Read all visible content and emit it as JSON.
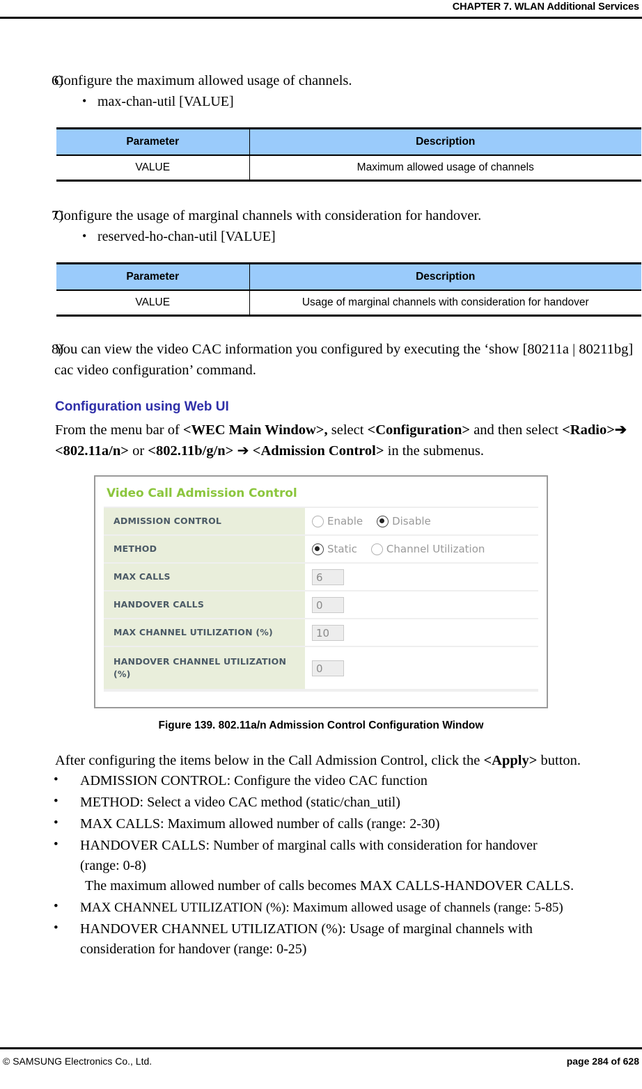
{
  "header": {
    "chapter_title": "CHAPTER 7. WLAN Additional Services"
  },
  "steps": [
    {
      "number": "6)",
      "text": "Configure the maximum allowed usage of channels.",
      "bullet": "max-chan-util  [VALUE]",
      "table": {
        "headers": [
          "Parameter",
          "Description"
        ],
        "rows": [
          [
            "VALUE",
            "Maximum allowed usage of channels"
          ]
        ]
      }
    },
    {
      "number": "7)",
      "text": "Configure the usage of marginal channels with consideration for handover.",
      "bullet": "reserved-ho-chan-util  [VALUE]",
      "table": {
        "headers": [
          "Parameter",
          "Description"
        ],
        "rows": [
          [
            "VALUE",
            "Usage of marginal channels with consideration for handover"
          ]
        ]
      }
    },
    {
      "number": "8)",
      "text": "You can view the video CAC information you configured by executing the ‘show [80211a | 80211bg] cac video configuration’ command."
    }
  ],
  "section": {
    "heading": "Configuration using Web UI",
    "paragraph_plain_1": "From the menu bar of ",
    "paragraph_bold_1": "<WEC Main Window>,",
    "paragraph_plain_2": " select ",
    "paragraph_bold_2": "<Configuration>",
    "paragraph_plain_3": " and then select ",
    "paragraph_bold_3": "<Radio>➔",
    "paragraph_bold_4": "<802.11a/n>",
    "paragraph_plain_4": " or ",
    "paragraph_bold_5": "<802.11b/g/n>",
    "paragraph_plain_5": " ➔ ",
    "paragraph_bold_6": "<Admission Control>",
    "paragraph_plain_6": " in the submenus."
  },
  "webui": {
    "panel_title": "Video Call Admission Control",
    "rows": [
      {
        "label": "ADMISSION CONTROL",
        "type": "radio",
        "options": [
          {
            "label": "Enable",
            "selected": false
          },
          {
            "label": "Disable",
            "selected": true
          }
        ]
      },
      {
        "label": "METHOD",
        "type": "radio",
        "options": [
          {
            "label": "Static",
            "selected": true
          },
          {
            "label": "Channel Utilization",
            "selected": false
          }
        ]
      },
      {
        "label": "MAX CALLS",
        "type": "input",
        "value": "6"
      },
      {
        "label": "HANDOVER CALLS",
        "type": "input",
        "value": "0"
      },
      {
        "label": "MAX CHANNEL UTILIZATION (%)",
        "type": "input",
        "value": "10"
      },
      {
        "label": "HANDOVER CHANNEL UTILIZATION (%)",
        "type": "input",
        "value": "0"
      }
    ],
    "colors": {
      "title": "#8cc63e",
      "label_bg": "#e9eedb",
      "label_text": "#4b5a66",
      "input_bg": "#ededed"
    }
  },
  "figure": {
    "caption": "Figure 139. 802.11a/n Admission Control Configuration Window"
  },
  "after_figure": {
    "intro_plain_1": "After configuring the items below in the Call Admission Control, click the ",
    "intro_bold": "<Apply>",
    "intro_plain_2": " button."
  },
  "bullets": [
    {
      "line1": "ADMISSION CONTROL: Configure the video CAC function"
    },
    {
      "line1": "METHOD: Select a video CAC method (static/chan_util)"
    },
    {
      "line1": "MAX CALLS: Maximum allowed number of calls (range: 2-30)"
    },
    {
      "line1": "HANDOVER CALLS: Number of marginal calls with consideration for handover",
      "line2": "(range: 0-8)",
      "line3": "The maximum allowed number of calls becomes MAX CALLS-HANDOVER CALLS."
    },
    {
      "line1": "MAX CHANNEL UTILIZATION (%): Maximum allowed usage of channels (range: 5-85)"
    },
    {
      "line1": "HANDOVER CHANNEL UTILIZATION (%): Usage of marginal channels with",
      "line2": "consideration for handover (range: 0-25)"
    }
  ],
  "footer": {
    "copyright": "© SAMSUNG Electronics Co., Ltd.",
    "page": "page 284 of 628"
  },
  "accent_colors": {
    "table_header_blue": "#9acbfb",
    "section_heading_blue": "#2f2fa8"
  }
}
